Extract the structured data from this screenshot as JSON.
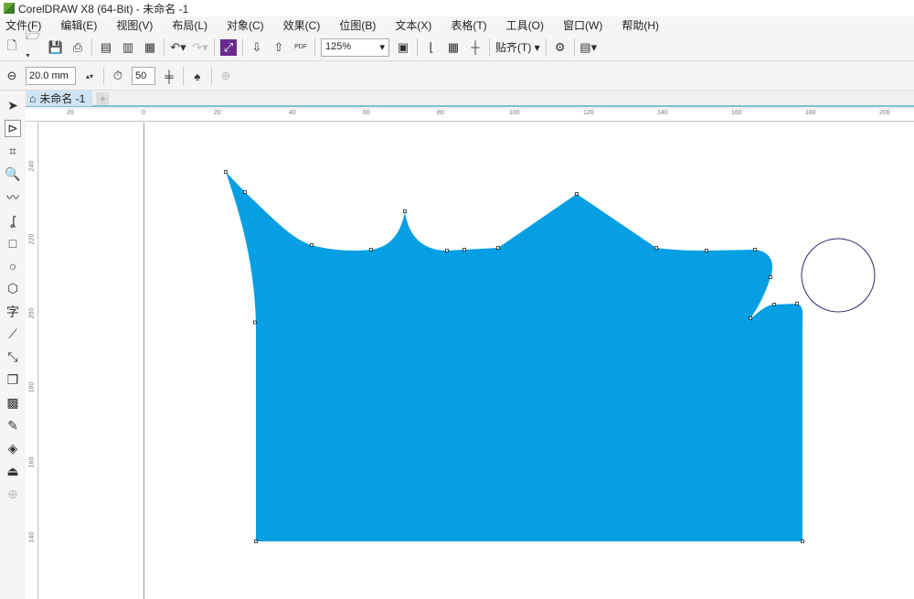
{
  "window": {
    "title": "CorelDRAW X8 (64-Bit) - 未命名 -1"
  },
  "menu": [
    "文件(F)",
    "编辑(E)",
    "视图(V)",
    "布局(L)",
    "对象(C)",
    "效果(C)",
    "位图(B)",
    "文本(X)",
    "表格(T)",
    "工具(O)",
    "窗口(W)",
    "帮助(H)"
  ],
  "toolbar": {
    "zoom": "125%",
    "snap": "贴齐(T)"
  },
  "property_bar": {
    "width": "20.0 mm",
    "count": "50"
  },
  "document_tab": "未命名 -1",
  "ruler_h": [
    "20",
    "0",
    "20",
    "40",
    "60",
    "80",
    "100",
    "120",
    "140",
    "160",
    "180",
    "200"
  ],
  "ruler_v": [
    "240",
    "220",
    "200",
    "180",
    "160",
    "140"
  ],
  "colors": {
    "fill": "#069fe3",
    "accent": "#7fbfcf"
  }
}
